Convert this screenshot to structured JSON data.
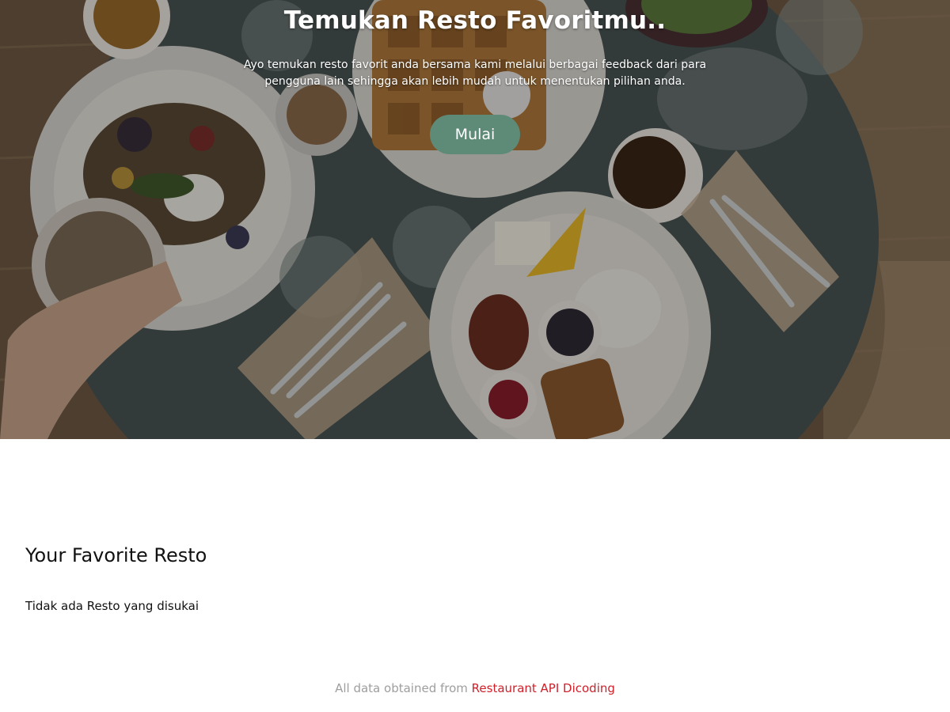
{
  "hero": {
    "title": "Temukan Resto Favoritmu..",
    "subtitle": "Ayo temukan resto favorit anda bersama kami melalui berbagai feedback dari para pengguna lain sehingga akan lebih mudah untuk menentukan pilihan anda.",
    "button_label": "Mulai",
    "button_color": "#5e8a78"
  },
  "favorites": {
    "title": "Your Favorite Resto",
    "empty_message": "Tidak ada Resto yang disukai"
  },
  "footer": {
    "prefix": "All data obtained from",
    "link_text": "Restaurant API Dicoding",
    "link_color": "#d0202a"
  }
}
